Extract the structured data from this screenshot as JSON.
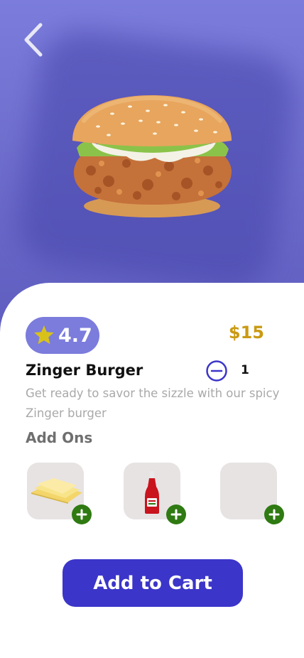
{
  "product": {
    "rating": "4.7",
    "price": "$15",
    "name": "Zinger Burger",
    "quantity": "1",
    "description": "Get ready to savor the sizzle with our spicy Zinger burger"
  },
  "addons": {
    "title": "Add Ons",
    "items": [
      {
        "icon": "cheese-slices-icon"
      },
      {
        "icon": "ketchup-bottle-icon"
      },
      {
        "icon": "empty-addon"
      }
    ]
  },
  "cta": {
    "label": "Add to Cart"
  },
  "colors": {
    "hero_bg": "#7b7cdc",
    "primary": "#3b35c9",
    "price": "#c99a12",
    "addon_plus": "#2f7a12",
    "rating_star": "#d8c21a"
  }
}
